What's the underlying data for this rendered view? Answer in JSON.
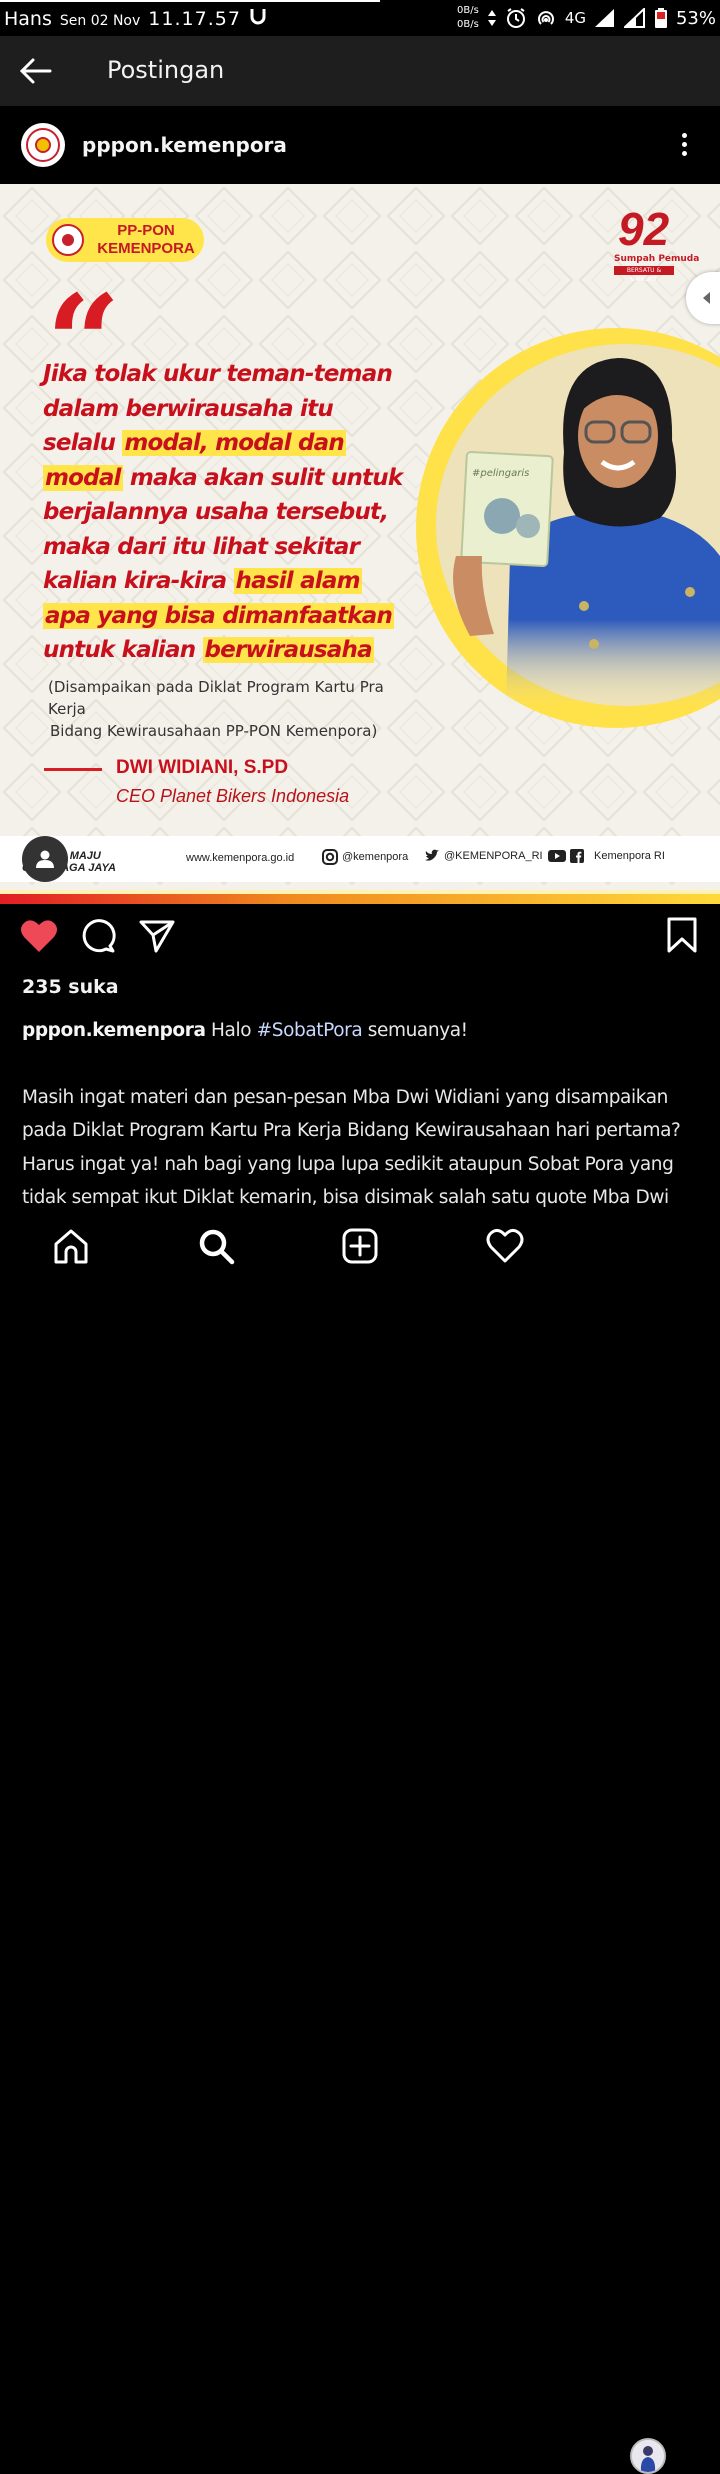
{
  "status_bar": {
    "carrier": "Hans",
    "date": "Sen 02 Nov",
    "time": "11.17.57",
    "net_up": "0B/s",
    "net_down": "0B/s",
    "network": "4G",
    "battery": "53%"
  },
  "app_bar": {
    "title": "Postingan",
    "back_icon": "arrow-left-icon"
  },
  "post": {
    "username": "pppon.kemenpora",
    "more_icon": "more-vertical-icon",
    "image": {
      "badge_line1": "PP-PON",
      "badge_line2": "KEMENPORA",
      "logo_number": "92",
      "logo_caption": "Sumpah Pemuda",
      "logo_band": "BERSATU & BANGKIT",
      "quote_mark": "“",
      "quote_lines": [
        [
          {
            "t": "Jika tolak ukur teman-teman",
            "h": false
          }
        ],
        [
          {
            "t": "dalam berwirausaha itu",
            "h": false
          }
        ],
        [
          {
            "t": "selalu ",
            "h": false
          },
          {
            "t": "modal, modal dan",
            "h": true
          }
        ],
        [
          {
            "t": "modal",
            "h": true
          },
          {
            "t": " maka akan sulit untuk",
            "h": false
          }
        ],
        [
          {
            "t": "berjalannya usaha tersebut,",
            "h": false
          }
        ],
        [
          {
            "t": "maka dari itu lihat sekitar",
            "h": false
          }
        ],
        [
          {
            "t": "kalian kira-kira ",
            "h": false
          },
          {
            "t": "hasil alam",
            "h": true
          }
        ],
        [
          {
            "t": "apa yang bisa dimanfaatkan",
            "h": true
          }
        ],
        [
          {
            "t": "untuk kalian ",
            "h": false
          },
          {
            "t": "berwirausaha",
            "h": true
          }
        ]
      ],
      "attribution_line1": "(Disampaikan pada Diklat Program Kartu Pra Kerja",
      "attribution_line2": "Bidang Kewirausahaan PP-PON Kemenpora)",
      "speaker_name": "DWI WIDIANI, S.PD",
      "speaker_role": "CEO Planet Bikers Indonesia",
      "book_title": "#pelingaris",
      "footer_tag_line1": "...DA MAJU",
      "footer_tag_line2": "OLAHRAGA JAYA",
      "footer_web": "www.kemenpora.go.id",
      "footer_instagram": "@kemenpora",
      "footer_twitter": "@KEMENPORA_RI",
      "footer_youtube_fb": "Kemenpora RI",
      "colors": {
        "red": "#c8101c",
        "yellow": "#ffe44a",
        "blue": "#1e4fb0"
      }
    },
    "actions": {
      "like_icon": "heart-filled-icon",
      "comment_icon": "comment-icon",
      "share_icon": "send-icon",
      "save_icon": "bookmark-icon"
    },
    "likes": "235 suka",
    "caption": {
      "username": "pppon.kemenpora",
      "text_before": " Halo ",
      "hashtag": "#SobatPora",
      "text_after": " semuanya!",
      "paragraph": "Masih ingat materi dan pesan-pesan Mba Dwi Widiani yang disampaikan pada Diklat Program Kartu Pra Kerja Bidang Kewirausahaan hari pertama? Harus ingat ya! nah bagi yang lupa lupa sedikit ataupun Sobat Pora yang tidak sempat ikut Diklat kemarin, bisa disimak salah satu quote Mba Dwi Widiani diatas ya!"
    }
  },
  "bottom_nav": {
    "items": [
      "home-icon",
      "search-icon",
      "new-post-icon",
      "activity-heart-icon",
      "profile-avatar"
    ]
  }
}
